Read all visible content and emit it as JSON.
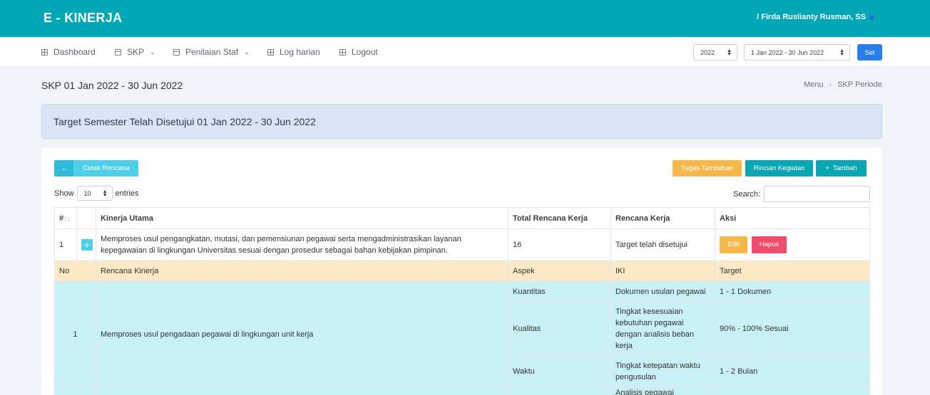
{
  "app": {
    "brand": "E - KINERJA",
    "user": "/ Firda Ruslianty Rusman, SS"
  },
  "nav": {
    "dashboard": "Dashboard",
    "skp": "SKP",
    "penilaian": "Penilaian Staf",
    "log": "Log harian",
    "logout": "Logout"
  },
  "period": {
    "year": "2022",
    "range": "1 Jan 2022 - 30 Jun 2022",
    "set_label": "Set"
  },
  "page": {
    "title": "SKP 01 Jan 2022 - 30 Jun 2022",
    "breadcrumb": [
      "Menu",
      "SKP Periode"
    ],
    "alert": "Target Semester Telah Disetujui 01 Jan 2022 - 30 Jun 2022"
  },
  "toolbar": {
    "cetak": "Cetak Rencana",
    "tugas": "Tugas Tambahan",
    "rincian": "Rincian Kegiatan",
    "tambah": "Tambah"
  },
  "table_controls": {
    "show": "Show",
    "length": "10",
    "entries": "entries",
    "search": "Search:"
  },
  "table": {
    "headers": [
      "#",
      "",
      "Kinerja Utama",
      "Total Rencana Kerja",
      "Rencana Kerja",
      "Aksi"
    ],
    "row": {
      "no": "1",
      "kinerja": "Memproses usul pengangkatan, mutasi, dan pemensiunan pegawai serta mengadministrasikan layanan kepegawaian di lingkungan Universitas sesuai dengan prosedur sebagai bahan kebijakan pimpinan.",
      "total": "16",
      "status": "Target telah disetujui",
      "edit": "Edit",
      "hapus": "Hapus"
    },
    "sub_headers": [
      "No",
      "Rencana Kinerja",
      "Aspek",
      "IKI",
      "Target"
    ],
    "sub_rows": [
      {
        "no": "1",
        "rencana": "Memproses usul pengadaan pegawai di lingkungan unit kerja",
        "aspects": [
          {
            "aspek": "Kuantitas",
            "iki": "Dokumen usulan pegawai",
            "target": "1 - 1 Dokumen"
          },
          {
            "aspek": "Kualitas",
            "iki": "Tingkat kesesuaian kebutuhan pegawai dengan analisis beban kerja",
            "target": "90% - 100% Sesuai"
          },
          {
            "aspek": "Waktu",
            "iki": "Tingkat ketepatan waktu pengusulan",
            "target": "1 - 2 Bulan"
          }
        ]
      },
      {
        "no": "",
        "rencana": "",
        "aspects": [
          {
            "aspek": "",
            "iki": "Analisis pegawai",
            "target": ""
          }
        ]
      }
    ]
  }
}
